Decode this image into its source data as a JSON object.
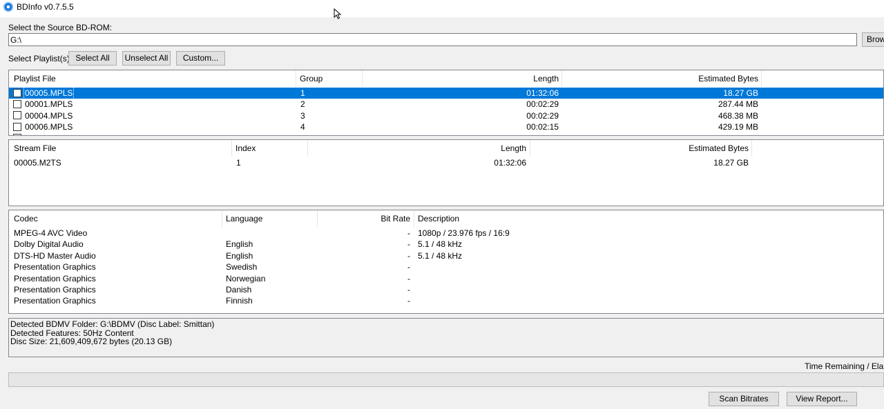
{
  "window": {
    "title": "BDInfo v0.7.5.5"
  },
  "source": {
    "label": "Select the Source BD-ROM:",
    "path": "G:\\",
    "browse_label": "Brows"
  },
  "playlist_controls": {
    "label": "Select Playlist(s):",
    "select_all": "Select All",
    "unselect_all": "Unselect All",
    "custom": "Custom..."
  },
  "playlists": {
    "columns": [
      "Playlist File",
      "Group",
      "Length",
      "Estimated Bytes"
    ],
    "rows": [
      {
        "file": "00005.MPLS",
        "group": "1",
        "length": "01:32:06",
        "bytes": "18.27 GB",
        "selected": true
      },
      {
        "file": "00001.MPLS",
        "group": "2",
        "length": "00:02:29",
        "bytes": "287.44 MB",
        "selected": false
      },
      {
        "file": "00004.MPLS",
        "group": "3",
        "length": "00:02:29",
        "bytes": "468.38 MB",
        "selected": false
      },
      {
        "file": "00006.MPLS",
        "group": "4",
        "length": "00:02:15",
        "bytes": "429.19 MB",
        "selected": false
      }
    ]
  },
  "streams": {
    "columns": [
      "Stream File",
      "Index",
      "Length",
      "Estimated Bytes"
    ],
    "rows": [
      {
        "file": "00005.M2TS",
        "index": "1",
        "length": "01:32:06",
        "bytes": "18.27 GB"
      }
    ]
  },
  "codecs": {
    "columns": [
      "Codec",
      "Language",
      "Bit Rate",
      "Description"
    ],
    "rows": [
      {
        "codec": "MPEG-4 AVC Video",
        "language": "",
        "bitrate": "-",
        "description": "1080p / 23.976 fps / 16:9"
      },
      {
        "codec": "Dolby Digital Audio",
        "language": "English",
        "bitrate": "-",
        "description": "5.1 / 48 kHz"
      },
      {
        "codec": "DTS-HD Master Audio",
        "language": "English",
        "bitrate": "-",
        "description": "5.1 / 48 kHz"
      },
      {
        "codec": "Presentation Graphics",
        "language": "Swedish",
        "bitrate": "-",
        "description": ""
      },
      {
        "codec": "Presentation Graphics",
        "language": "Norwegian",
        "bitrate": "-",
        "description": ""
      },
      {
        "codec": "Presentation Graphics",
        "language": "Danish",
        "bitrate": "-",
        "description": ""
      },
      {
        "codec": "Presentation Graphics",
        "language": "Finnish",
        "bitrate": "-",
        "description": ""
      }
    ]
  },
  "status": {
    "lines": [
      "Detected BDMV Folder: G:\\BDMV (Disc Label: Smittan)",
      "Detected Features: 50Hz Content",
      "Disc Size: 21,609,409,672 bytes (20.13 GB)"
    ]
  },
  "footer": {
    "time_label": "Time Remaining / Elapse",
    "scan_bitrates": "Scan Bitrates",
    "view_report": "View Report...",
    "progress_fraction": 0
  }
}
